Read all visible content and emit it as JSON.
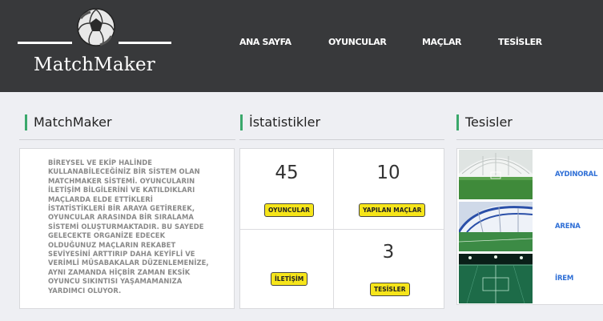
{
  "header": {
    "brand": "MatchMaker",
    "nav": [
      {
        "label": "ANA SAYFA"
      },
      {
        "label": "OYUNCULAR"
      },
      {
        "label": "MAÇLAR"
      },
      {
        "label": "TESİSLER"
      }
    ]
  },
  "sections": {
    "about_title": "MatchMaker",
    "stats_title": "İstatistikler",
    "facilities_title": "Tesisler"
  },
  "about": {
    "text": "BİREYSEL VE EKİP HALİNDE KULLANABİLECEĞİNİZ BİR SİSTEM OLAN MATCHMAKER SİSTEMİ. OYUNCULARIN İLETİŞİM BİLGİLERİNİ VE KATILDIKLARI MAÇLARDA ELDE ETTİKLERİ İSTATİSTİKLERİ BİR ARAYA GETİREREK, OYUNCULAR ARASINDA BİR SIRALAMA SİSTEMİ OLUŞTURMAKTADIR. BU SAYEDE GELECEKTE ORGANİZE EDECEK OLDUĞUNUZ MAÇLARIN REKABET SEVİYESİNİ ARTTIRIP DAHA KEYİFLİ VE VERİMLİ MÜSABAKALAR DÜZENLEMENİZE, AYNI ZAMANDA HİÇBİR ZAMAN EKSİK OYUNCU SIKINTISI YAŞAMAMANIZA YARDIMCI OLUYOR."
  },
  "stats": [
    {
      "value": "45",
      "label": "OYUNCULAR"
    },
    {
      "value": "10",
      "label": "YAPILAN MAÇLAR"
    },
    {
      "value": "",
      "label": "İLETİŞİM"
    },
    {
      "value": "3",
      "label": "TESİSLER"
    }
  ],
  "facilities": [
    {
      "name": "AYDINORAL"
    },
    {
      "name": "ARENA"
    },
    {
      "name": "İREM"
    }
  ],
  "colors": {
    "header_bg": "#38393b",
    "accent_green": "#3aa86b",
    "badge_yellow": "#f6e51a",
    "link_blue": "#2f6fd6",
    "page_bg": "#eeeff3"
  },
  "icons": {
    "logo": "soccer-ball-icon"
  }
}
